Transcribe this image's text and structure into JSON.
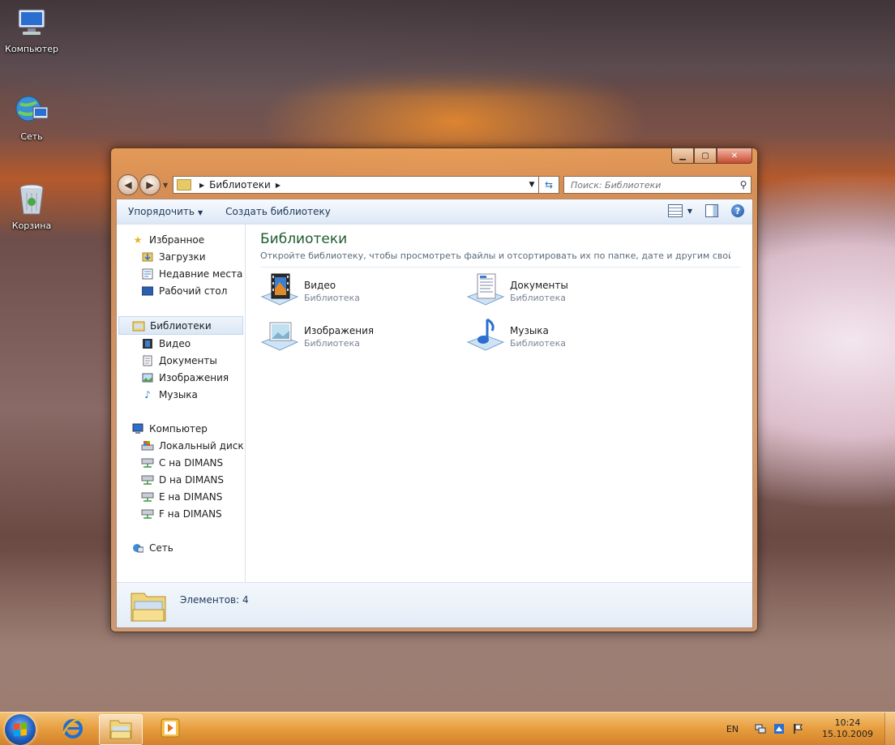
{
  "desktop": {
    "icons": [
      {
        "label": "Компьютер",
        "icon": "computer-icon"
      },
      {
        "label": "Сеть",
        "icon": "network-icon"
      },
      {
        "label": "Корзина",
        "icon": "recycle-bin-icon"
      }
    ]
  },
  "window": {
    "caption_buttons": {
      "minimize": "▁",
      "maximize": "▢",
      "close": "✕"
    },
    "address": {
      "path": "Библиотеки"
    },
    "search": {
      "placeholder": "Поиск: Библиотеки"
    },
    "toolbar": {
      "organize_label": "Упорядочить",
      "new_library_label": "Создать библиотеку"
    },
    "nav": {
      "favorites": {
        "label": "Избранное",
        "items": [
          "Загрузки",
          "Недавние места",
          "Рабочий стол"
        ]
      },
      "libraries": {
        "label": "Библиотеки",
        "items": [
          "Видео",
          "Документы",
          "Изображения",
          "Музыка"
        ]
      },
      "computer": {
        "label": "Компьютер",
        "items": [
          "Локальный диск (C",
          "C на DIMANS",
          "D на DIMANS",
          "E на DIMANS",
          "F на DIMANS"
        ]
      },
      "network": {
        "label": "Сеть"
      }
    },
    "content": {
      "title": "Библиотеки",
      "description": "Откройте библиотеку, чтобы просмотреть файлы и отсортировать их по папке, дате и другим свойств...",
      "libraries": [
        {
          "name": "Видео",
          "type": "Библиотека",
          "icon": "video-library-icon"
        },
        {
          "name": "Документы",
          "type": "Библиотека",
          "icon": "documents-library-icon"
        },
        {
          "name": "Изображения",
          "type": "Библиотека",
          "icon": "pictures-library-icon"
        },
        {
          "name": "Музыка",
          "type": "Библиотека",
          "icon": "music-library-icon"
        }
      ]
    },
    "details": {
      "count": "Элементов: 4"
    }
  },
  "taskbar": {
    "language": "EN",
    "time": "10:24",
    "date": "15.10.2009"
  },
  "colors": {
    "accent": "#e89a3c",
    "title_green": "#1e5c2e",
    "link_blue": "#1e395b"
  }
}
